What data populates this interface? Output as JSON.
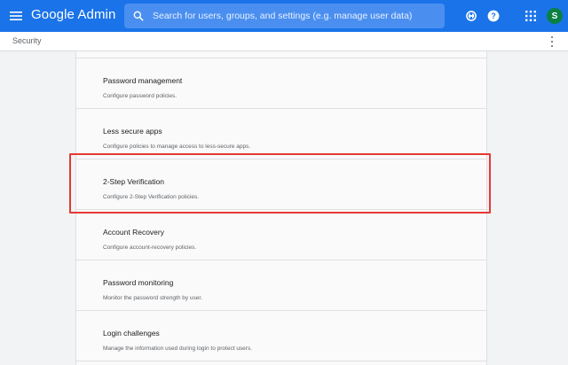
{
  "app": {
    "title": "Google Admin",
    "menu_icon": "hamburger-menu-icon",
    "search": {
      "placeholder": "Search for users, groups, and settings (e.g. manage user data)",
      "value": "",
      "icon": "search-icon"
    },
    "actions": [
      {
        "name": "support-icon"
      },
      {
        "name": "help-icon",
        "glyph": "?"
      },
      {
        "name": "apps-grid-icon"
      }
    ],
    "avatar_initial": "S"
  },
  "breadcrumb": {
    "label": "Security",
    "more_icon": "more-vert-icon"
  },
  "settings": [
    {
      "title": "Password management",
      "description": "Configure password policies."
    },
    {
      "title": "Less secure apps",
      "description": "Configure policies to manage access to less-secure apps."
    },
    {
      "title": "2-Step Verification",
      "description": "Configure 2-Step Verification policies."
    },
    {
      "title": "Account Recovery",
      "description": "Configure account-recovery policies."
    },
    {
      "title": "Password monitoring",
      "description": "Monitor the password strength by user."
    },
    {
      "title": "Login challenges",
      "description": "Manage the information used during login to protect users."
    }
  ],
  "colors": {
    "appbar": "#1a73e8",
    "highlight": "#e53935",
    "avatar": "#0b8043"
  }
}
